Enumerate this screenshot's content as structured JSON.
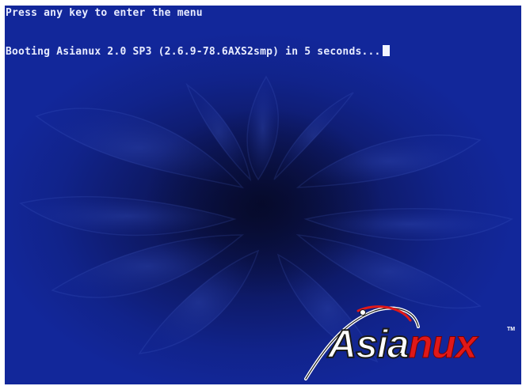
{
  "boot_screen": {
    "prompt_line": "Press any key to enter the menu",
    "boot_message": "Booting Asianux 2.0 SP3 (2.6.9-78.6AXS2smp) in 5 seconds...",
    "background_color": "#12279a",
    "text_color": "#e8ecff"
  },
  "logo": {
    "text_part_1": "Asia",
    "text_part_2": "nux",
    "trademark": "TM",
    "accent_color": "#e01818"
  }
}
